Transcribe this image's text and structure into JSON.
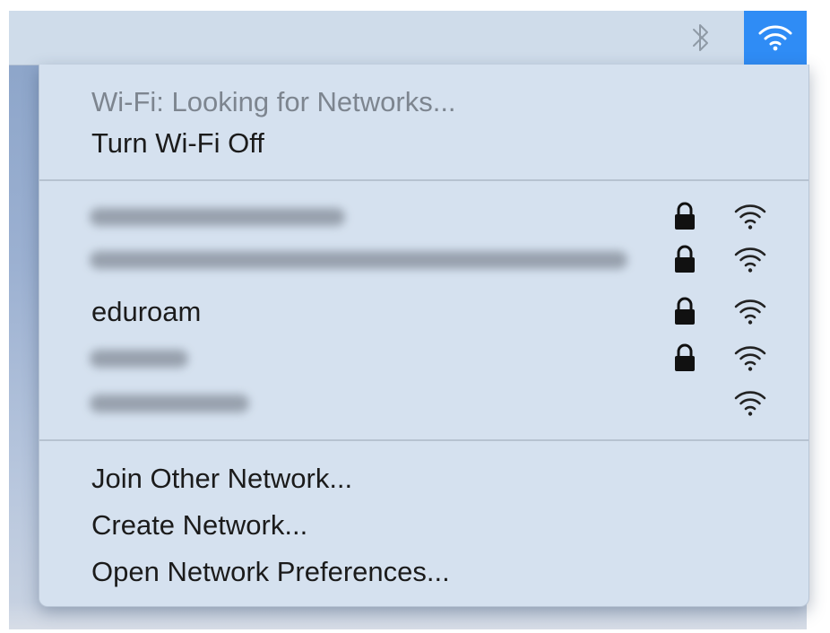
{
  "menubar": {
    "bluetooth_icon": "bluetooth-icon",
    "wifi_icon": "wifi-icon",
    "wifi_highlight_color": "#2f8cf5"
  },
  "menu": {
    "status": "Wi-Fi: Looking for Networks...",
    "toggle": "Turn Wi-Fi Off",
    "networks": [
      {
        "name": "",
        "obscured": true,
        "locked": true
      },
      {
        "name": "",
        "obscured": true,
        "locked": true
      },
      {
        "name": "eduroam",
        "obscured": false,
        "locked": true
      },
      {
        "name": "",
        "obscured": true,
        "locked": true
      },
      {
        "name": "",
        "obscured": true,
        "locked": false
      }
    ],
    "join_other": "Join Other Network...",
    "create": "Create Network...",
    "preferences": "Open Network Preferences..."
  }
}
